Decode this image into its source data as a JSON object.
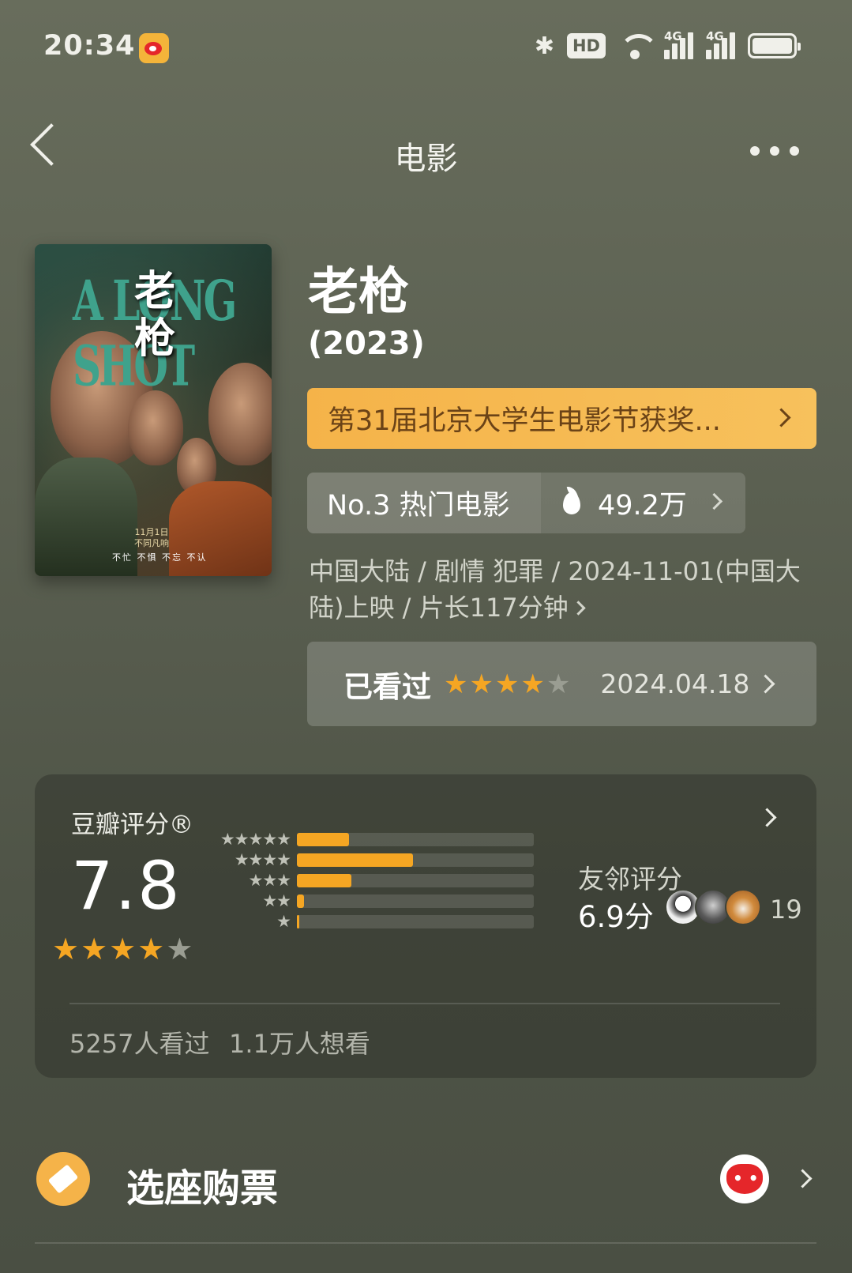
{
  "status_bar": {
    "time": "20:34",
    "hd_label": "HD",
    "signal_label_1": "4G",
    "signal_label_2": "4G"
  },
  "nav": {
    "title": "电影"
  },
  "poster": {
    "title_en": "A LONG SHOT",
    "title_zh": "老枪",
    "release_note": "11月1日\n不同凡响",
    "tagline": "不忙 不惧 不忘 不认"
  },
  "movie": {
    "title": "老枪",
    "year": "(2023)",
    "award": "第31届北京大学生电影节获奖...",
    "rank": "No.3 热门电影",
    "heat": "49.2万",
    "info": "中国大陆 / 剧情 犯罪 / 2024-11-01(中国大陆)上映 / 片长117分钟"
  },
  "watched": {
    "label": "已看过",
    "user_rating": 4,
    "max_rating": 5,
    "date": "2024.04.18"
  },
  "rating": {
    "label": "豆瓣评分®",
    "score": "7.8",
    "stars": 4,
    "distribution": [
      {
        "stars": "★★★★★",
        "fraction": 0.22
      },
      {
        "stars": "★★★★",
        "fraction": 0.49
      },
      {
        "stars": "★★★",
        "fraction": 0.23
      },
      {
        "stars": "★★",
        "fraction": 0.03
      },
      {
        "stars": "★",
        "fraction": 0.01
      }
    ],
    "friend_label": "友邻评分",
    "friend_score": "6.9分",
    "friend_count": "19",
    "watched_count": "5257人看过",
    "want_count": "1.1万人想看"
  },
  "ticket": {
    "label": "选座购票"
  },
  "colors": {
    "accent": "#f5a623",
    "award_bg": "#f5b349",
    "background": "#5c6152"
  }
}
